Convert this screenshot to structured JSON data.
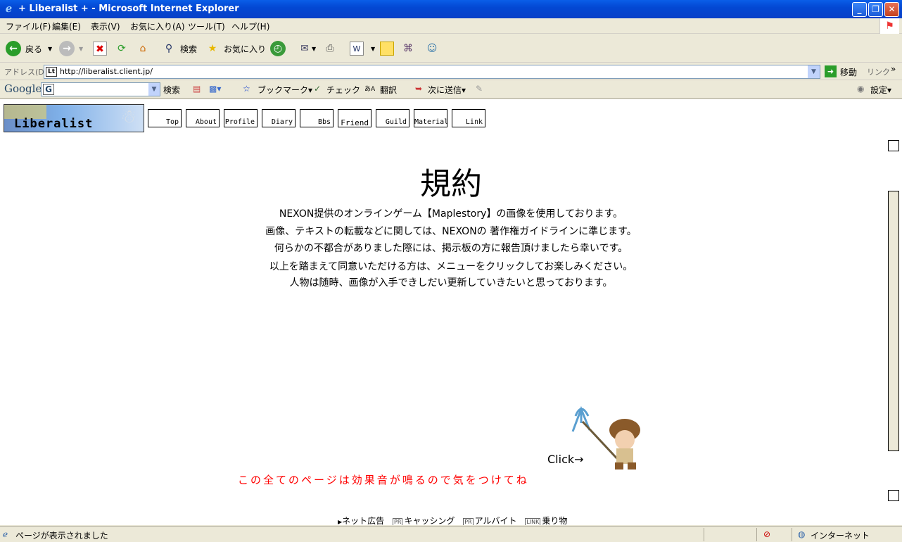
{
  "window": {
    "title": "+ Liberalist + - Microsoft Internet Explorer"
  },
  "menu": [
    "ファイル(F)",
    "編集(E)",
    "表示(V)",
    "お気に入り(A)",
    "ツール(T)",
    "ヘルプ(H)"
  ],
  "toolbar": {
    "back": "戻る",
    "search": "検索",
    "favorites": "お気に入り"
  },
  "address": {
    "label": "アドレス(D)",
    "url": "http://liberalist.client.jp/",
    "go": "移動",
    "links": "リンク"
  },
  "google": {
    "brand": "Google",
    "search": "検索",
    "bookmarks": "ブックマーク▾",
    "check": "チェック",
    "translate": "翻訳",
    "send": "次に送信▾",
    "settings": "設定▾"
  },
  "site": {
    "logo": "Liberalist",
    "nav": [
      "Top",
      "About",
      "Profile",
      "Diary",
      "Bbs",
      "Friend",
      "Guild",
      "Material",
      "Link"
    ],
    "heading": "規約",
    "paragraphs": [
      "NEXON提供のオンラインゲーム【Maplestory】の画像を使用しております。",
      "画像、テキストの転載などに関しては、NEXONの 著作権ガイドラインに準じます。",
      "何らかの不都合がありました際には、掲示板の方に報告頂けましたら幸いです。",
      "以上を踏まえて同意いただける方は、メニューをクリックしてお楽しみください。",
      "人物は随時、画像が入手できしだい更新していきたいと思っております。"
    ],
    "click": "Click→",
    "warning": "この全てのページは効果音が鳴るので気をつけてね",
    "ads": {
      "ad1": "ネット広告",
      "pr1": "PR",
      "ad2": "キャッシング",
      "pr2": "PR",
      "ad3": "アルバイト",
      "link": "LINK",
      "ad4": "乗り物"
    }
  },
  "status": {
    "text": "ページが表示されました",
    "zone": "インターネット"
  }
}
